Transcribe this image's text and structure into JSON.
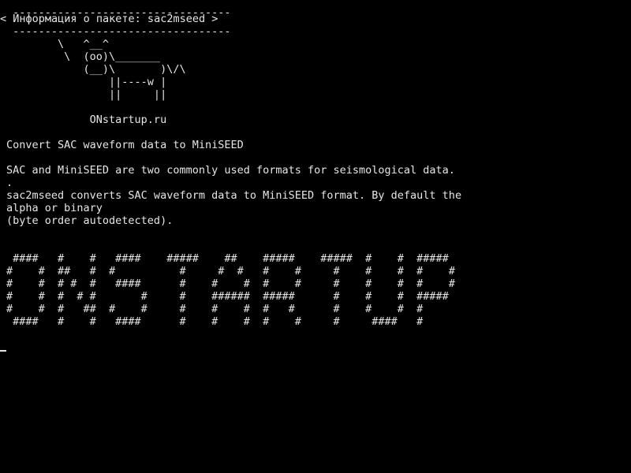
{
  "terminal": {
    "lines": [
      " ----------------------------------",
      "< Информация о пакете: sac2mseed >",
      " ----------------------------------",
      "        \\   ^__^",
      "         \\  (oo)\\_______",
      "            (__)\\       )\\/\\",
      "                ||----w |",
      "                ||     ||",
      "",
      "             ONstartup.ru",
      "",
      "Convert SAC waveform data to MiniSEED",
      "",
      "SAC and MiniSEED are two commonly used formats for seismological data.",
      ".",
      "sac2mseed converts SAC waveform data to MiniSEED format. By default the",
      "alpha or binary",
      "(byte order autodetected).",
      "",
      "",
      " ####   #    #   ####    #####    ##    #####    #####  #    #  #####",
      "#    #  ##   #  #          #     #  #   #    #     #    #    #  #    #",
      "#    #  # #  #   ####      #    #    #  #    #     #    #    #  #    #",
      "#    #  #  # #       #     #    ######  #####      #    #    #  #####",
      "#    #  #   ##  #    #     #    #    #  #   #      #    #    #  #",
      " ####   #    #   ####      #    #    #  #    #     #     ####   #"
    ]
  }
}
